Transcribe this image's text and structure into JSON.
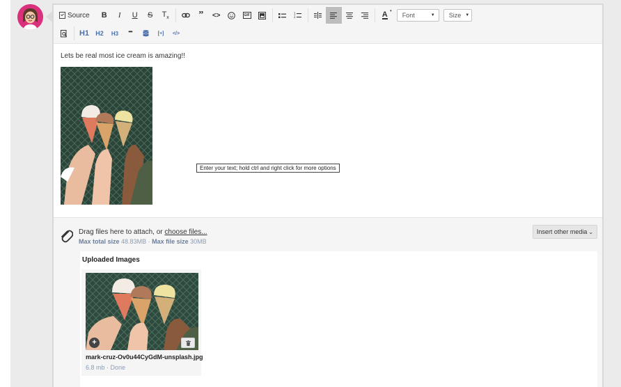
{
  "toolbar": {
    "source_label": "Source",
    "font_select": "Font",
    "size_select": "Size",
    "h1": "H1",
    "h2": "H2",
    "h3": "H3",
    "icons": [
      "source-icon",
      "bold-icon",
      "italic-icon",
      "underline-icon",
      "strikethrough-icon",
      "clear-format-icon",
      "link-icon",
      "quote-icon",
      "code-icon",
      "emoji-icon",
      "gif-icon",
      "image-icon",
      "bullet-list-icon",
      "numbered-list-icon",
      "indent-icon",
      "align-left-icon",
      "align-center-icon",
      "align-right-icon",
      "text-color-icon",
      "preview-icon",
      "more-icon",
      "database-icon",
      "spoiler-icon",
      "html-code-icon"
    ],
    "bold": "B",
    "italic": "I",
    "underline": "U",
    "strike": "S",
    "clear_format": "T",
    "clear_format_sub": "x",
    "text_color": "A",
    "gif": "GIF",
    "more": "•••",
    "spoiler": "[≡]",
    "code": "<>",
    "html_code": "</>"
  },
  "content": {
    "text": "Lets be real most ice cream is amazing!!",
    "tooltip": "Enter your text; hold ctrl and right click for more options"
  },
  "attachments": {
    "drag_text": "Drag files here to attach, or ",
    "choose_files": "choose files...",
    "max_total_label": "Max total size",
    "max_total_value": "48.83MB",
    "separator": "·",
    "max_file_label": "Max file size",
    "max_file_value": "30MB",
    "insert_media": "Insert other media",
    "insert_media_caret": "⌄",
    "uploaded_title": "Uploaded Images",
    "file_name": "mark-cruz-Ov0u44CyGdM-unsplash.jpg",
    "file_meta": "6.8 mb · Done",
    "plus": "+"
  },
  "colors": {
    "avatar": "#d9317c",
    "active_button": "#bdbdbd",
    "heading_buttons": "#4a6ea9",
    "meta_text": "#8a9bb3"
  }
}
